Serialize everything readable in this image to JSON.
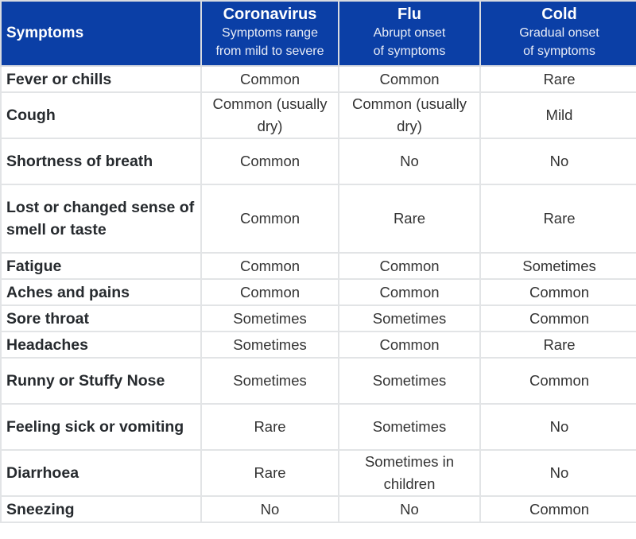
{
  "header": {
    "symptoms_label": "Symptoms",
    "columns": [
      {
        "name": "Coronavirus",
        "desc_line1": "Symptoms range",
        "desc_line2": "from mild to severe"
      },
      {
        "name": "Flu",
        "desc_line1": "Abrupt onset",
        "desc_line2": "of symptoms"
      },
      {
        "name": "Cold",
        "desc_line1": "Gradual onset",
        "desc_line2": "of symptoms"
      }
    ]
  },
  "rows": [
    {
      "symptom": "Fever or chills",
      "coronavirus": "Common",
      "flu": "Common",
      "cold": "Rare"
    },
    {
      "symptom": "Cough",
      "coronavirus": "Common (usually dry)",
      "flu": "Common (usually dry)",
      "cold": "Mild"
    },
    {
      "symptom": "Shortness of breath",
      "coronavirus": "Common",
      "flu": "No",
      "cold": "No"
    },
    {
      "symptom": "Lost or changed sense of smell or taste",
      "coronavirus": "Common",
      "flu": "Rare",
      "cold": "Rare"
    },
    {
      "symptom": "Fatigue",
      "coronavirus": "Common",
      "flu": "Common",
      "cold": "Sometimes"
    },
    {
      "symptom": "Aches and pains",
      "coronavirus": "Common",
      "flu": "Common",
      "cold": "Common"
    },
    {
      "symptom": "Sore throat",
      "coronavirus": "Sometimes",
      "flu": "Sometimes",
      "cold": "Common"
    },
    {
      "symptom": "Headaches",
      "coronavirus": "Sometimes",
      "flu": "Common",
      "cold": "Rare"
    },
    {
      "symptom": "Runny or Stuffy Nose",
      "coronavirus": "Sometimes",
      "flu": "Sometimes",
      "cold": "Common"
    },
    {
      "symptom": "Feeling sick or vomiting",
      "coronavirus": "Rare",
      "flu": "Sometimes",
      "cold": "No"
    },
    {
      "symptom": "Diarrhoea",
      "coronavirus": "Rare",
      "flu": "Sometimes in children",
      "cold": "No"
    },
    {
      "symptom": "Sneezing",
      "coronavirus": "No",
      "flu": "No",
      "cold": "Common"
    }
  ],
  "colors": {
    "header_bg": "#0b3fa6",
    "header_text": "#ffffff",
    "grid_line": "#e2e4e6",
    "body_text": "#2b2d30"
  }
}
